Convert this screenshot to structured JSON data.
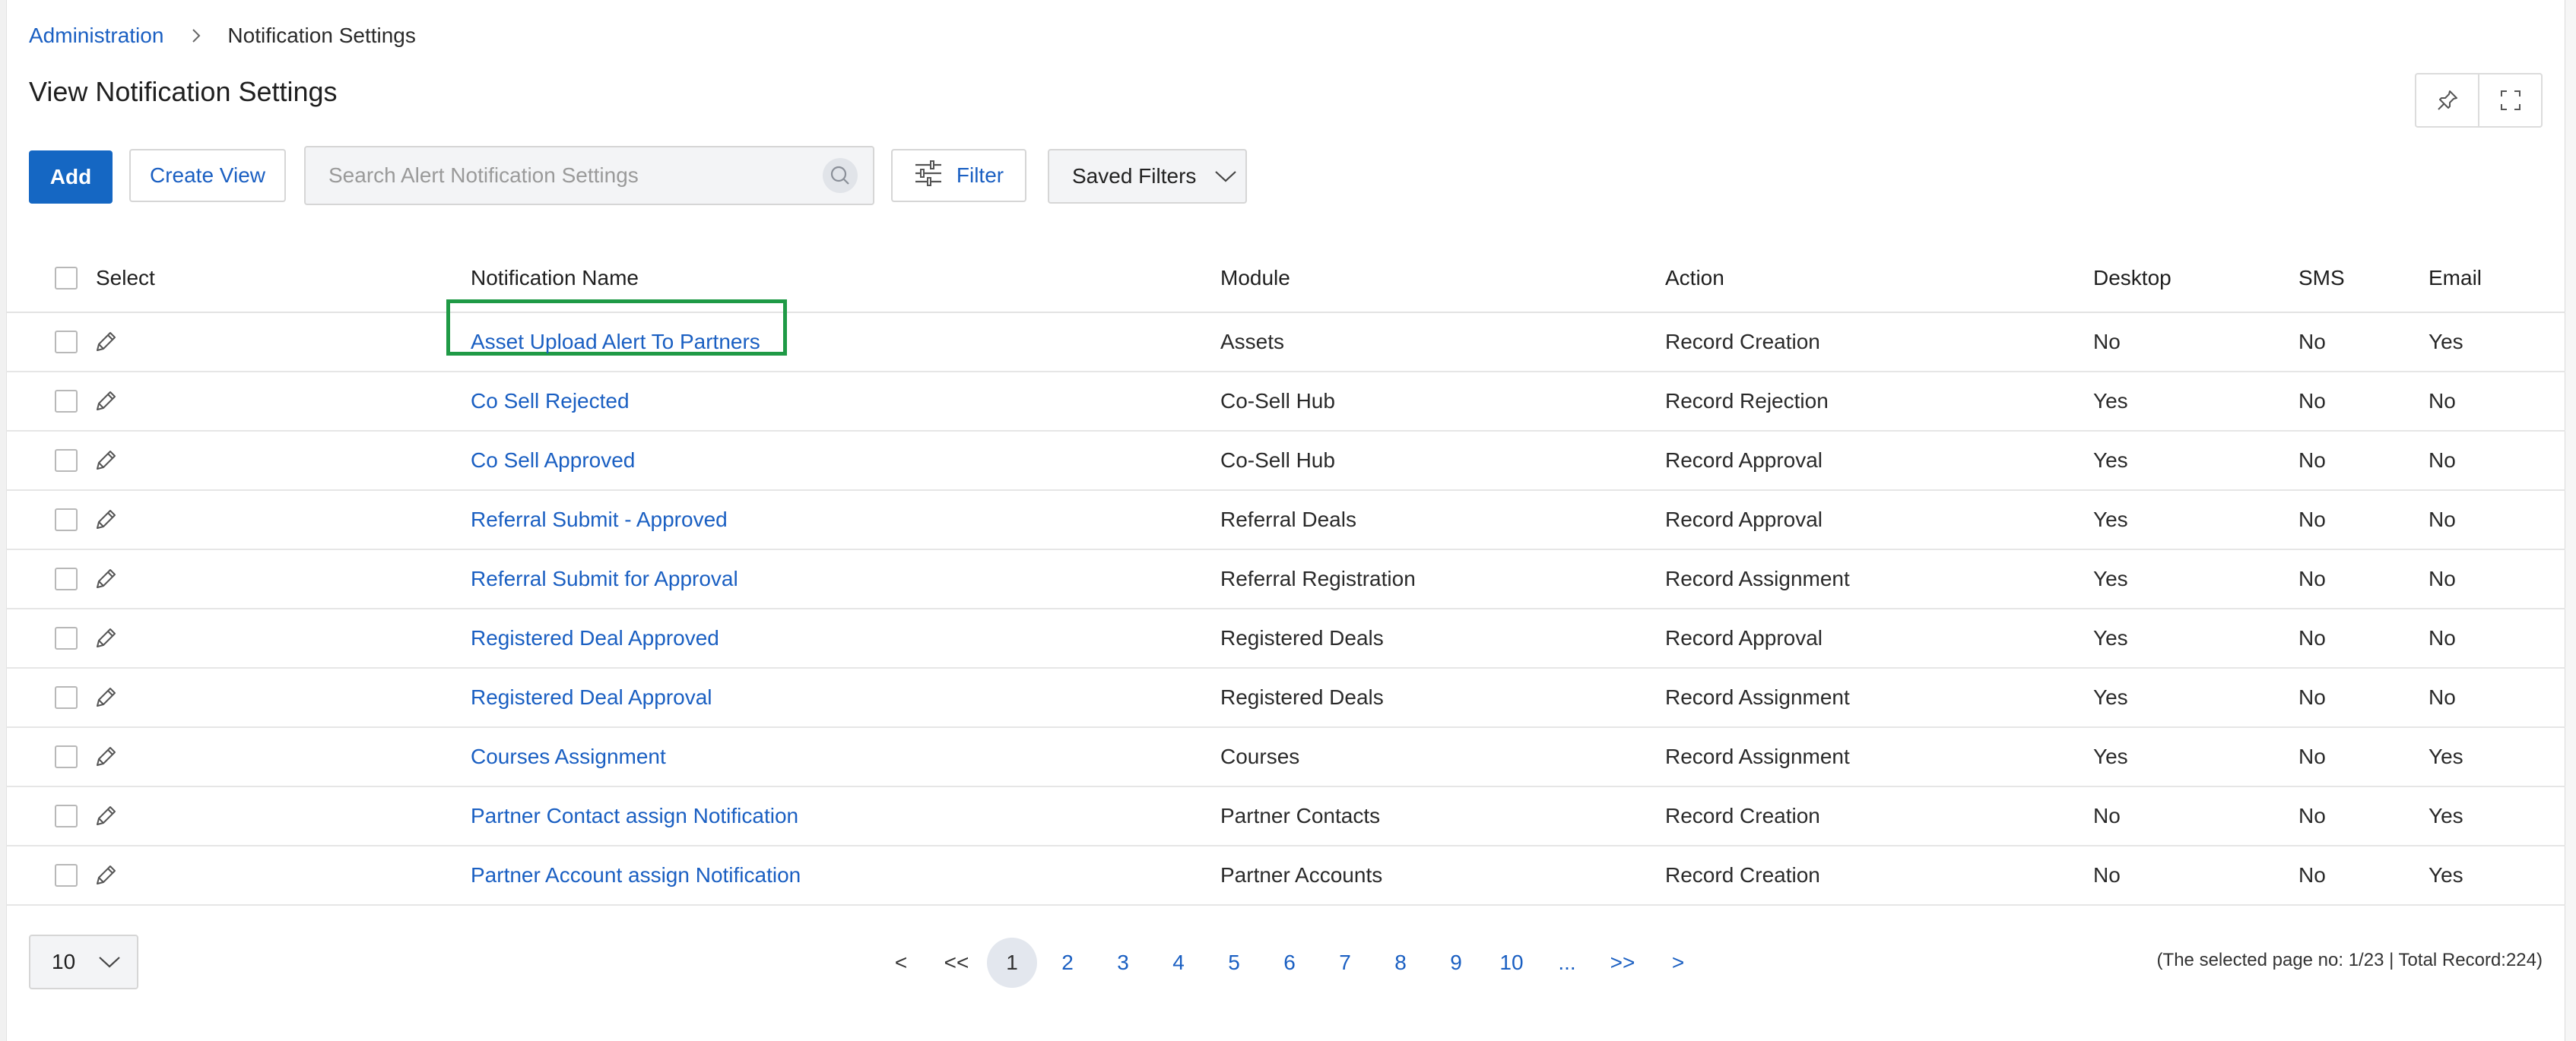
{
  "breadcrumb": {
    "parent": "Administration",
    "current": "Notification Settings"
  },
  "page": {
    "title": "View Notification Settings"
  },
  "toolbar": {
    "add_label": "Add",
    "create_view_label": "Create View",
    "search_placeholder": "Search Alert Notification Settings",
    "filter_label": "Filter",
    "saved_filters_label": "Saved Filters"
  },
  "table": {
    "headers": {
      "select": "Select",
      "name": "Notification Name",
      "module": "Module",
      "action": "Action",
      "desktop": "Desktop",
      "sms": "SMS",
      "email": "Email"
    },
    "rows": [
      {
        "name": "Asset Upload Alert To Partners",
        "module": "Assets",
        "action": "Record Creation",
        "desktop": "No",
        "sms": "No",
        "email": "Yes"
      },
      {
        "name": "Co Sell Rejected",
        "module": "Co-Sell Hub",
        "action": "Record Rejection",
        "desktop": "Yes",
        "sms": "No",
        "email": "No"
      },
      {
        "name": "Co Sell Approved",
        "module": "Co-Sell Hub",
        "action": "Record Approval",
        "desktop": "Yes",
        "sms": "No",
        "email": "No"
      },
      {
        "name": "Referral Submit - Approved",
        "module": "Referral Deals",
        "action": "Record Approval",
        "desktop": "Yes",
        "sms": "No",
        "email": "No"
      },
      {
        "name": "Referral Submit for Approval",
        "module": "Referral Registration",
        "action": "Record Assignment",
        "desktop": "Yes",
        "sms": "No",
        "email": "No"
      },
      {
        "name": "Registered Deal Approved",
        "module": "Registered Deals",
        "action": "Record Approval",
        "desktop": "Yes",
        "sms": "No",
        "email": "No"
      },
      {
        "name": "Registered Deal Approval",
        "module": "Registered Deals",
        "action": "Record Assignment",
        "desktop": "Yes",
        "sms": "No",
        "email": "No"
      },
      {
        "name": "Courses Assignment",
        "module": "Courses",
        "action": "Record Assignment",
        "desktop": "Yes",
        "sms": "No",
        "email": "Yes"
      },
      {
        "name": "Partner Contact assign Notification",
        "module": "Partner Contacts",
        "action": "Record Creation",
        "desktop": "No",
        "sms": "No",
        "email": "Yes"
      },
      {
        "name": "Partner Account assign Notification",
        "module": "Partner Accounts",
        "action": "Record Creation",
        "desktop": "No",
        "sms": "No",
        "email": "Yes"
      }
    ]
  },
  "pagination": {
    "page_size": "10",
    "first": "<<",
    "prev": "<",
    "pages": [
      "1",
      "2",
      "3",
      "4",
      "5",
      "6",
      "7",
      "8",
      "9",
      "10"
    ],
    "ellipsis": "...",
    "next_block": ">>",
    "next": ">",
    "active_page": "1",
    "info": "(The selected page no: 1/23 | Total Record:224)"
  },
  "colors": {
    "link": "#1a5fc2",
    "primary_button": "#1567c3",
    "highlight_box": "#1f9a46"
  }
}
